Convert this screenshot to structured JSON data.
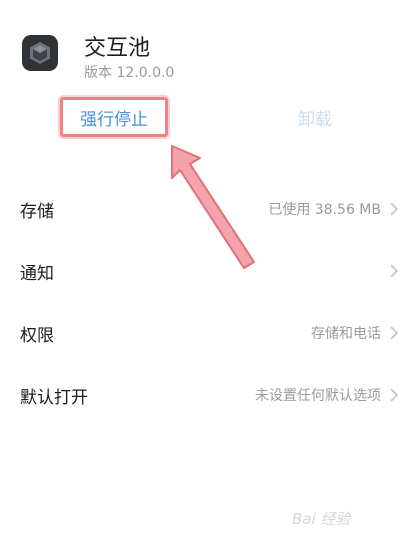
{
  "app": {
    "name": "交互池",
    "version": "版本 12.0.0.0"
  },
  "actions": {
    "force_stop": "强行停止",
    "uninstall": "卸载"
  },
  "settings": [
    {
      "label": "存储",
      "value": "已使用 38.56 MB"
    },
    {
      "label": "通知",
      "value": ""
    },
    {
      "label": "权限",
      "value": "存储和电话"
    },
    {
      "label": "默认打开",
      "value": "未设置任何默认选项"
    }
  ],
  "watermark": "Bai 经验",
  "colors": {
    "accent": "#4a90d9",
    "highlight": "#f07f88"
  },
  "icons": [
    "app-icon",
    "chevron-right-icon",
    "annotation-arrow"
  ]
}
